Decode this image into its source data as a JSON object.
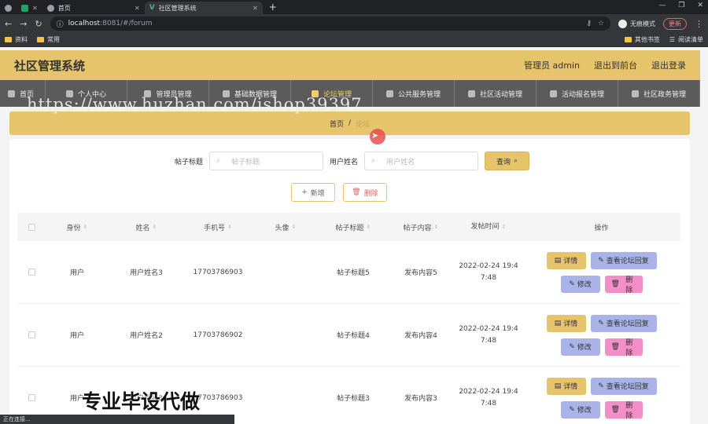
{
  "browser": {
    "tabs": [
      {
        "label": ""
      },
      {
        "label": ""
      },
      {
        "label": "首页"
      },
      {
        "label": "社区管理系统"
      }
    ],
    "address": {
      "host": "localhost",
      "rest": ":8081/#/forum"
    },
    "profile_label": "无痕模式",
    "update_label": "更新",
    "bookmarks": [
      "资料",
      "常用"
    ],
    "bookmarks_right": [
      "其他书签",
      "阅读清单"
    ]
  },
  "header": {
    "title": "社区管理系统",
    "admin": "管理员 admin",
    "back_front": "退出到前台",
    "logout": "退出登录"
  },
  "nav": [
    {
      "label": "首页"
    },
    {
      "label": "个人中心"
    },
    {
      "label": "管理员管理"
    },
    {
      "label": "基础数据管理"
    },
    {
      "label": "论坛管理"
    },
    {
      "label": "公共服务管理"
    },
    {
      "label": "社区活动管理"
    },
    {
      "label": "活动报名管理"
    },
    {
      "label": "社区政务管理"
    }
  ],
  "breadcrumb": {
    "home": "首页",
    "sep": "/",
    "current": "论坛"
  },
  "search": {
    "title_label": "帖子标题",
    "title_placeholder": "帖子标题",
    "user_label": "用户姓名",
    "user_placeholder": "用户姓名",
    "query": "查询"
  },
  "actions": {
    "add": "新增",
    "delete": "删除"
  },
  "table": {
    "headers": [
      "身份",
      "姓名",
      "手机号",
      "头像",
      "帖子标题",
      "帖子内容",
      "发帖时间",
      "操作"
    ],
    "rows": [
      {
        "role": "用户",
        "name": "用户姓名3",
        "phone": "17703786903",
        "title": "帖子标题5",
        "content": "发布内容5",
        "time1": "2022-02-24 19:4",
        "time2": "7:48"
      },
      {
        "role": "用户",
        "name": "用户姓名2",
        "phone": "17703786902",
        "title": "帖子标题4",
        "content": "发布内容4",
        "time1": "2022-02-24 19:4",
        "time2": "7:48"
      },
      {
        "role": "用户",
        "name": "用户姓名3",
        "phone": "17703786903",
        "title": "帖子标题3",
        "content": "发布内容3",
        "time1": "2022-02-24 19:4",
        "time2": "7:48"
      }
    ],
    "ops": {
      "detail": "详情",
      "reply": "查看论坛回复",
      "edit": "修改",
      "remove": "删除"
    }
  },
  "overlay": {
    "watermark": "https://www.huzhan.com/ishop39397",
    "promo": "专业毕设代做"
  },
  "status": "正在连接..."
}
